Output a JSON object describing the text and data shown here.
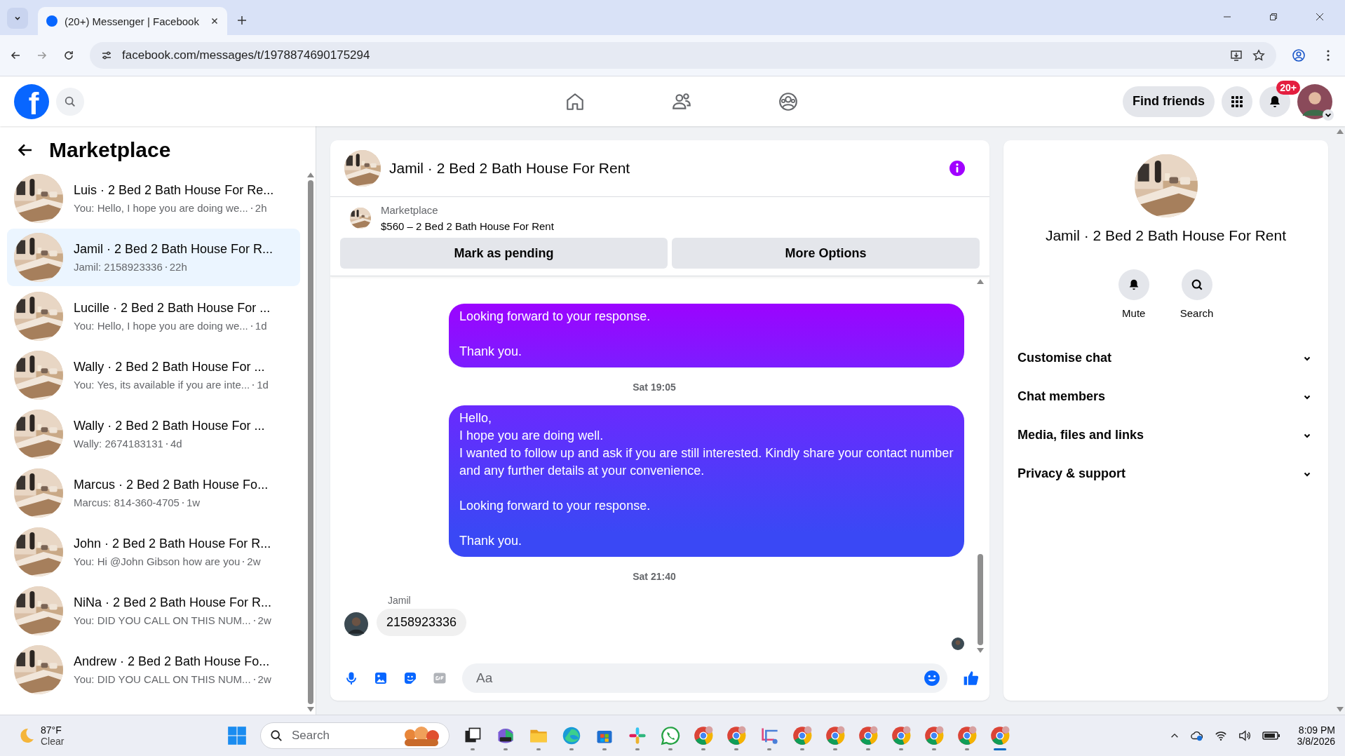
{
  "browser": {
    "tab_title": "(20+) Messenger | Facebook",
    "url": "facebook.com/messages/t/1978874690175294"
  },
  "header": {
    "logo": "f",
    "find_friends": "Find friends",
    "notification_badge": "20+"
  },
  "sidebar": {
    "title": "Marketplace",
    "conversations": [
      {
        "title": "Luis · 2 Bed 2 Bath House For Re...",
        "preview": "You: Hello, I hope you are doing we...",
        "time": "2h",
        "selected": false
      },
      {
        "title": "Jamil · 2 Bed 2 Bath House For R...",
        "preview": "Jamil: 2158923336",
        "time": "22h",
        "selected": true
      },
      {
        "title": "Lucille · 2 Bed 2 Bath House For ...",
        "preview": "You: Hello, I hope you are doing we...",
        "time": "1d",
        "selected": false
      },
      {
        "title": "Wally · 2 Bed 2 Bath House For ...",
        "preview": "You: Yes, its available if you are inte...",
        "time": "1d",
        "selected": false
      },
      {
        "title": "Wally · 2 Bed 2 Bath House For ...",
        "preview": "Wally: 2674183131",
        "time": "4d",
        "selected": false
      },
      {
        "title": "Marcus · 2 Bed 2 Bath House Fo...",
        "preview": "Marcus: 814-360-4705",
        "time": "1w",
        "selected": false
      },
      {
        "title": "John · 2 Bed 2 Bath House For R...",
        "preview": "You: Hi @John Gibson how are you",
        "time": "2w",
        "selected": false
      },
      {
        "title": "NiNa · 2 Bed 2 Bath House For R...",
        "preview": "You: DID YOU CALL ON THIS NUM...",
        "time": "2w",
        "selected": false
      },
      {
        "title": "Andrew · 2 Bed 2 Bath House Fo...",
        "preview": "You: DID YOU CALL ON THIS NUM...",
        "time": "2w",
        "selected": false
      }
    ]
  },
  "chat": {
    "title": "Jamil · 2 Bed 2 Bath House For Rent",
    "listing": {
      "label": "Marketplace",
      "item": "$560 – 2 Bed 2 Bath House For Rent"
    },
    "actions": [
      "Mark as pending",
      "More Options"
    ],
    "messages": [
      {
        "kind": "outgoing",
        "text": "Looking forward to your response.\n\nThank you."
      },
      {
        "kind": "timestamp",
        "text": "Sat 19:05"
      },
      {
        "kind": "outgoing",
        "text": "Hello,\nI hope you are doing well.\nI wanted to follow up and ask if you are still interested. Kindly share your contact number and any further details at your convenience.\n\nLooking forward to your response.\n\nThank you."
      },
      {
        "kind": "timestamp",
        "text": "Sat 21:40"
      },
      {
        "kind": "incoming",
        "sender": "Jamil",
        "text": "2158923336"
      }
    ],
    "composer": {
      "placeholder": "Aa"
    }
  },
  "details": {
    "title": "Jamil · 2 Bed 2 Bath House For Rent",
    "actions": [
      {
        "kind": "bell",
        "label": "Mute"
      },
      {
        "kind": "search",
        "label": "Search"
      }
    ],
    "sections": [
      {
        "label": "Customise chat",
        "expanded": false
      },
      {
        "label": "Chat members",
        "expanded": false
      },
      {
        "label": "Media, files and links",
        "expanded": false
      },
      {
        "label": "Privacy & support",
        "expanded": false
      }
    ]
  },
  "taskbar": {
    "weather": {
      "temp": "87°F",
      "condition": "Clear"
    },
    "search_placeholder": "Search",
    "apps": [
      {
        "kind": "taskview",
        "selected": false
      },
      {
        "kind": "office",
        "selected": false
      },
      {
        "kind": "folder",
        "selected": false
      },
      {
        "kind": "edge",
        "selected": false
      },
      {
        "kind": "store",
        "selected": false
      },
      {
        "kind": "slack",
        "selected": false
      },
      {
        "kind": "whatsapp",
        "selected": false
      },
      {
        "kind": "chrome",
        "selected": false
      },
      {
        "kind": "chrome",
        "selected": false
      },
      {
        "kind": "snip",
        "selected": false
      },
      {
        "kind": "chrome",
        "selected": false
      },
      {
        "kind": "chrome",
        "selected": false
      },
      {
        "kind": "chrome",
        "selected": false
      },
      {
        "kind": "chrome",
        "selected": false
      },
      {
        "kind": "chrome",
        "selected": false
      },
      {
        "kind": "chrome",
        "selected": false
      },
      {
        "kind": "chrome",
        "selected": true
      }
    ],
    "time": "8:09 PM",
    "date": "3/8/2026"
  }
}
